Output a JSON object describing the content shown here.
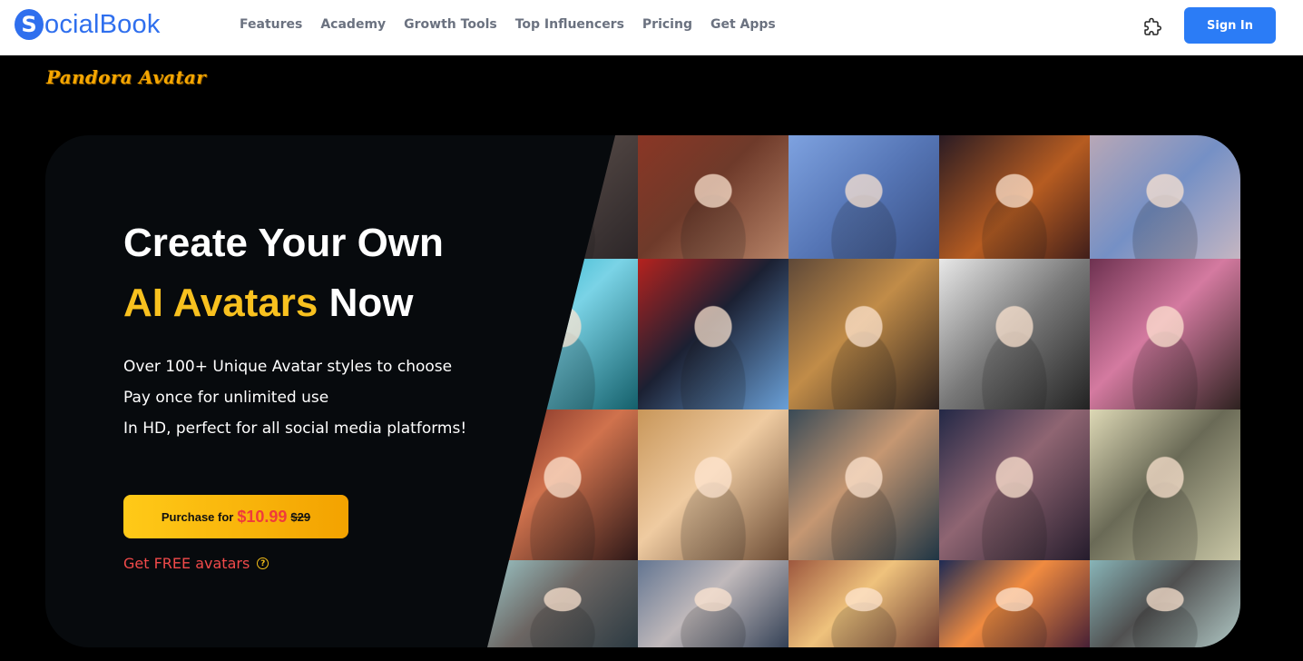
{
  "navbar": {
    "logo_letter": "S",
    "logo_text": "ocialBook",
    "links": [
      "Features",
      "Academy",
      "Growth Tools",
      "Top Influencers",
      "Pricing",
      "Get Apps"
    ],
    "sign_in_label": "Sign In"
  },
  "page": {
    "brand": "Pandora Avatar"
  },
  "hero": {
    "headline_line1": "Create Your Own",
    "headline_accent": "AI Avatars",
    "headline_tail": "Now",
    "features": [
      "Over 100+ Unique Avatar styles to choose",
      "Pay once for unlimited use",
      "In HD, perfect for all social media platforms!"
    ],
    "purchase": {
      "label": "Purchase for",
      "price": "$10.99",
      "old_price": "$29"
    },
    "free_link": "Get FREE avatars",
    "help_icon": "?"
  },
  "gallery": {
    "avatar_tiles": 20
  }
}
